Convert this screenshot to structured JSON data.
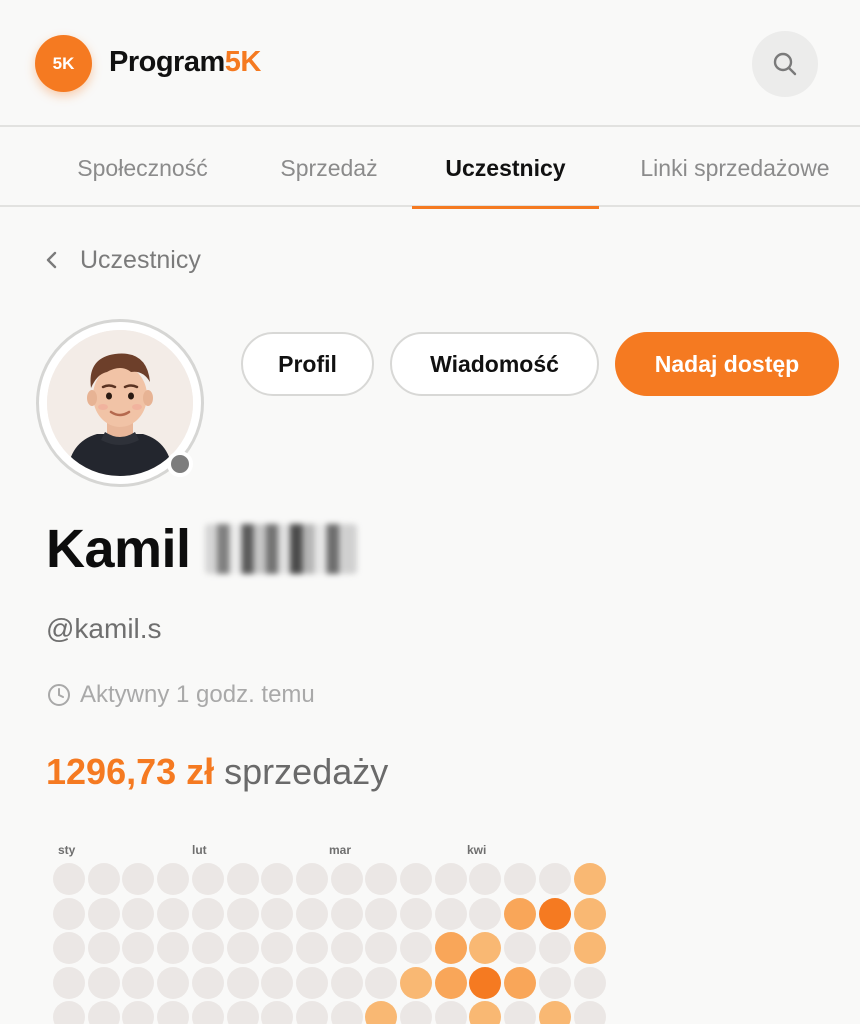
{
  "header": {
    "logo_badge": "5K",
    "brand_main": "Program",
    "brand_accent": "5K",
    "search_icon": "search-icon"
  },
  "tabs": [
    {
      "label": "Społeczność",
      "active": false
    },
    {
      "label": "Sprzedaż",
      "active": false
    },
    {
      "label": "Uczestnicy",
      "active": true
    },
    {
      "label": "Linki sprzedażowe",
      "active": false
    }
  ],
  "breadcrumb": {
    "icon": "chevron-left-icon",
    "label": "Uczestnicy"
  },
  "profile": {
    "avatar": "avatar-illustration",
    "status": "offline",
    "first_name": "Kamil",
    "last_name_redacted": true,
    "handle": "@kamil.s",
    "activity_icon": "clock-icon",
    "activity": "Aktywny 1 godz. temu"
  },
  "actions": {
    "profile_label": "Profil",
    "message_label": "Wiadomość",
    "grant_label": "Nadaj dostęp"
  },
  "sales": {
    "amount": "1296,73 zł",
    "label": "sprzedaży"
  },
  "activity_calendar": {
    "months": [
      "sty",
      "lut",
      "mar",
      "kwi"
    ],
    "levels_legend": {
      "0": "#ebe7e5",
      "1": "#f9b873",
      "2": "#f9a659",
      "3": "#f57a21"
    },
    "rows": [
      [
        0,
        0,
        0,
        0,
        0,
        0,
        0,
        0,
        0,
        0,
        0,
        0,
        0,
        0,
        0,
        1
      ],
      [
        0,
        0,
        0,
        0,
        0,
        0,
        0,
        0,
        0,
        0,
        0,
        0,
        0,
        2,
        3,
        1
      ],
      [
        0,
        0,
        0,
        0,
        0,
        0,
        0,
        0,
        0,
        0,
        0,
        2,
        1,
        0,
        0,
        1
      ],
      [
        0,
        0,
        0,
        0,
        0,
        0,
        0,
        0,
        0,
        0,
        1,
        2,
        3,
        2,
        0,
        0
      ],
      [
        0,
        0,
        0,
        0,
        0,
        0,
        0,
        0,
        0,
        1,
        0,
        0,
        1,
        0,
        1,
        0
      ]
    ]
  },
  "colors": {
    "accent": "#f57a21",
    "background": "#f9f9f8"
  }
}
